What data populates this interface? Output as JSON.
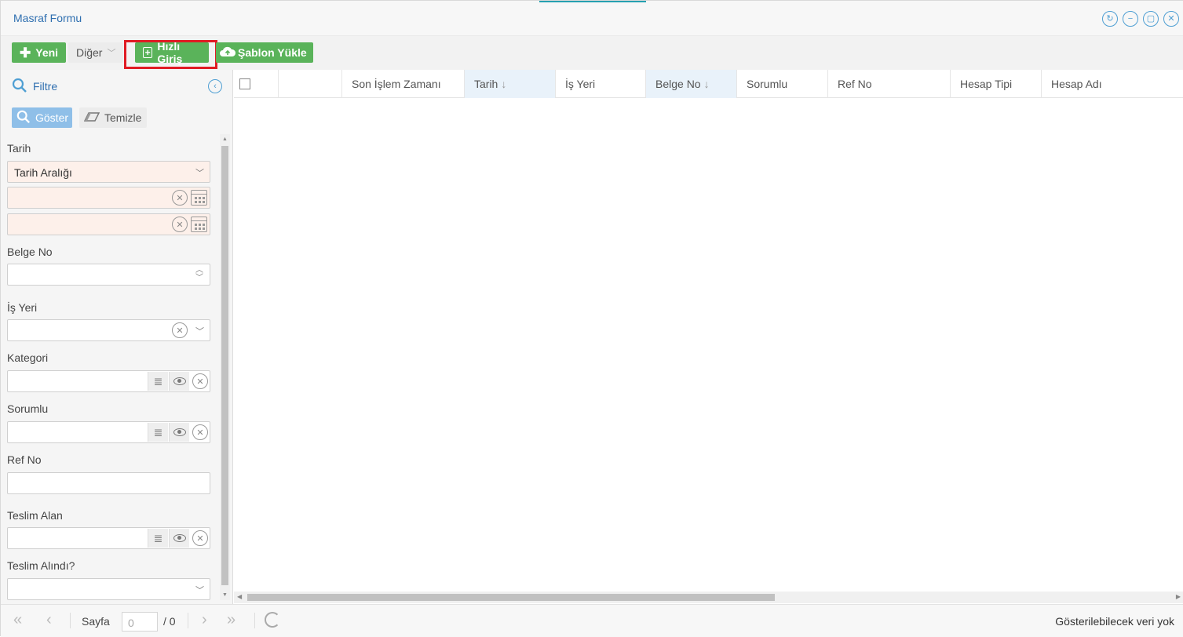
{
  "window": {
    "title": "Masraf Formu"
  },
  "toolbar": {
    "new_label": "Yeni",
    "other_label": "Diğer",
    "quick_entry_label": "Hızlı Giriş",
    "load_template_label": "Şablon Yükle"
  },
  "filter": {
    "title": "Filtre",
    "show_label": "Göster",
    "clear_label": "Temizle",
    "fields": {
      "date_label": "Tarih",
      "date_range_value": "Tarih Aralığı",
      "doc_no_label": "Belge No",
      "workplace_label": "İş Yeri",
      "category_label": "Kategori",
      "responsible_label": "Sorumlu",
      "ref_no_label": "Ref No",
      "received_by_label": "Teslim Alan",
      "received_label": "Teslim Alındı?"
    }
  },
  "grid": {
    "columns": [
      "",
      "Son İşlem Zamanı",
      "Tarih",
      "İş Yeri",
      "Belge No",
      "Sorumlu",
      "Ref No",
      "Hesap Tipi",
      "Hesap Adı"
    ],
    "rows": []
  },
  "pager": {
    "page_label": "Sayfa",
    "page_value": "0",
    "page_total": "/ 0",
    "status": "Gösterilebilecek veri yok"
  },
  "colors": {
    "accent": "#2f6fb0",
    "green": "#5ab35a",
    "highlight": "#e01b24"
  }
}
